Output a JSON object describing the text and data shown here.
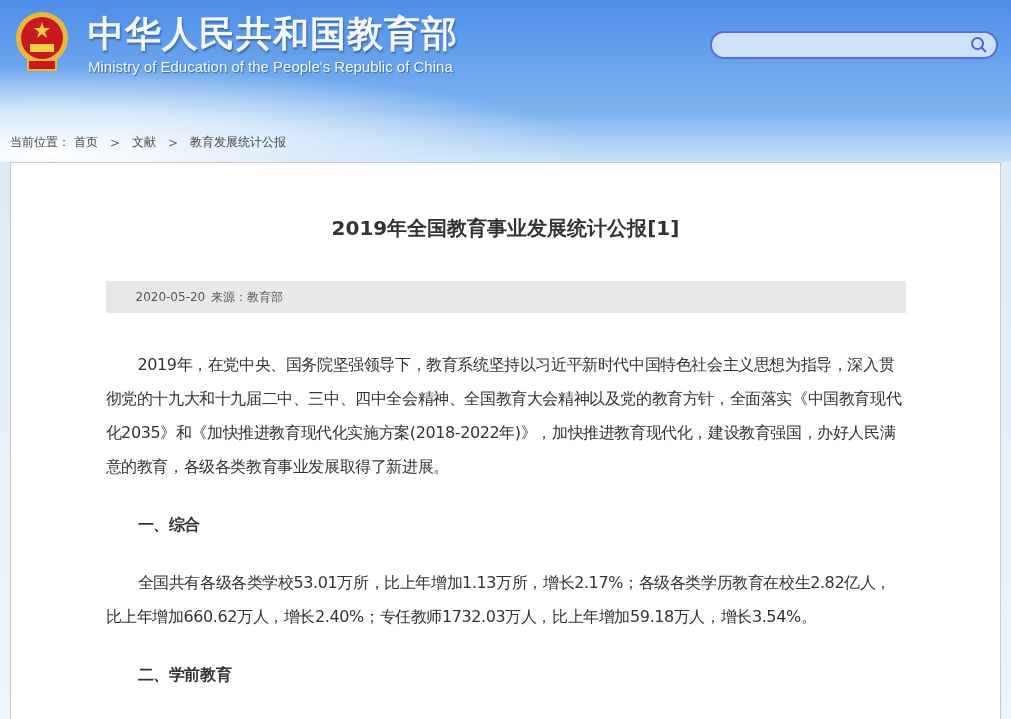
{
  "header": {
    "title": "中华人民共和国教育部",
    "subtitle": "Ministry of Education of the People's Republic of China"
  },
  "breadcrumb": {
    "label": "当前位置：",
    "items": [
      "首页",
      "文献",
      "教育发展统计公报"
    ],
    "separator": ">"
  },
  "article": {
    "title": "2019年全国教育事业发展统计公报[1]",
    "date": "2020-05-20",
    "source": "来源：教育部",
    "blocks": [
      {
        "kind": "paragraph",
        "text": "2019年，在党中央、国务院坚强领导下，教育系统坚持以习近平新时代中国特色社会主义思想为指导，深入贯彻党的十九大和十九届二中、三中、四中全会精神、全国教育大会精神以及党的教育方针，全面落实《中国教育现代化2035》和《加快推进教育现代化实施方案(2018-2022年)》，加快推进教育现代化，建设教育强国，办好人民满意的教育，各级各类教育事业发展取得了新进展。"
      },
      {
        "kind": "heading",
        "text": "一、综合"
      },
      {
        "kind": "paragraph",
        "text": "全国共有各级各类学校53.01万所，比上年增加1.13万所，增长2.17%；各级各类学历教育在校生2.82亿人，比上年增加660.62万人，增长2.40%；专任教师1732.03万人，比上年增加59.18万人，增长3.54%。"
      },
      {
        "kind": "heading",
        "text": "二、学前教育"
      }
    ]
  }
}
